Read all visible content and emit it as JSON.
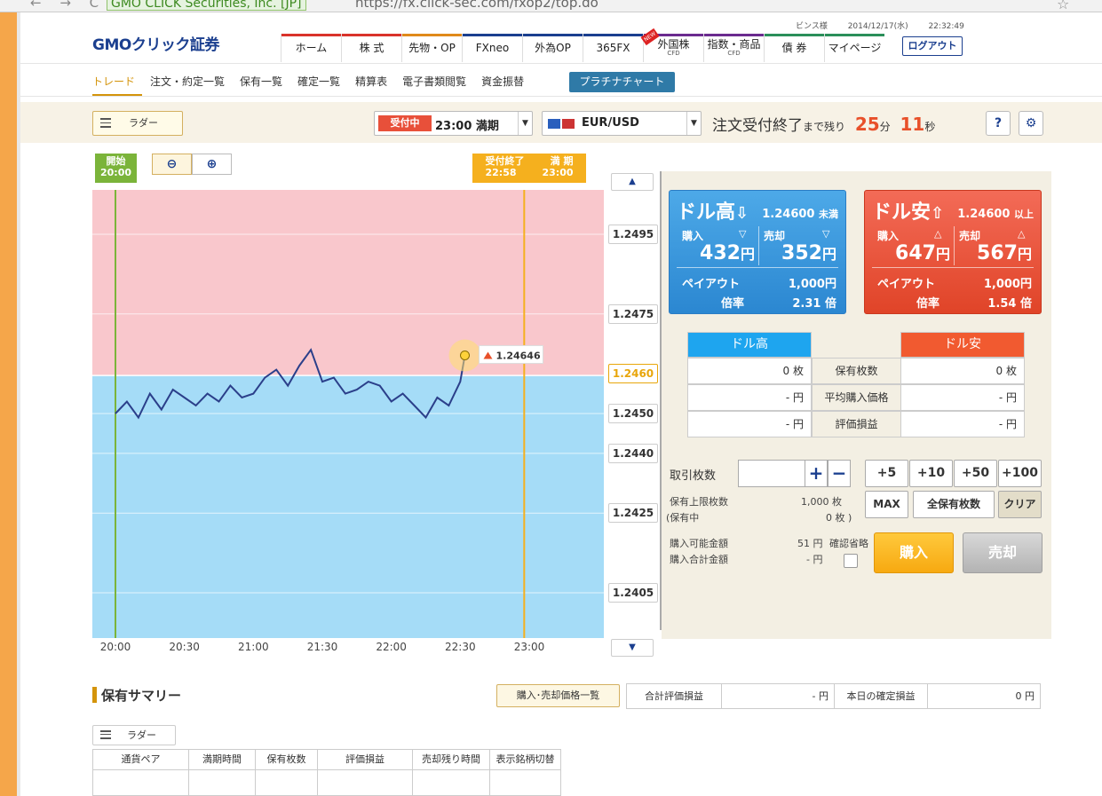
{
  "browser": {
    "secure_label": "GMO CLICK Securities, Inc. [JP]",
    "url": "https://fx.click-sec.com/fxop2/top.do"
  },
  "header": {
    "logo_text": "GMOクリック証券",
    "user": "ビンス様",
    "datetime": "2014/12/17(水) 22:32:49",
    "nav": [
      {
        "label": "ホーム",
        "sub": "",
        "color": "#d9322b"
      },
      {
        "label": "株 式",
        "sub": "",
        "color": "#d9322b"
      },
      {
        "label": "先物・OP",
        "sub": "",
        "color": "#e08a1a"
      },
      {
        "label": "FXneo",
        "sub": "",
        "color": "#1b3f8f"
      },
      {
        "label": "外為OP",
        "sub": "",
        "color": "#1b3f8f"
      },
      {
        "label": "365FX",
        "sub": "",
        "color": "#1b3f8f"
      },
      {
        "label": "外国株",
        "sub": "CFD",
        "color": "#6b2b8f",
        "new": "NEW"
      },
      {
        "label": "指数・商品",
        "sub": "CFD",
        "color": "#6b2b8f"
      },
      {
        "label": "債 券",
        "sub": "",
        "color": "#2b8f5a"
      },
      {
        "label": "マイページ",
        "sub": "",
        "color": "#2b8f5a"
      }
    ],
    "logout": "ログアウト"
  },
  "subnav": {
    "items": [
      "トレード",
      "注文・約定一覧",
      "保有一覧",
      "確定一覧",
      "精算表",
      "電子書類閲覧",
      "資金振替"
    ],
    "active": 0,
    "platinum": "プラチナチャート"
  },
  "controls": {
    "ladder": "ラダー",
    "status_badge": "受付中",
    "expiry": "23:00 満期",
    "pair": "EUR/USD",
    "deadline_label": "注文受付終了",
    "deadline_small": "まで残り",
    "minutes": "25",
    "min_unit": "分",
    "seconds": "11",
    "sec_unit": "秒",
    "help": "?"
  },
  "chart": {
    "start_label": "開始",
    "start_time": "20:00",
    "end_label": "受付終了",
    "end_time": "22:58",
    "expiry_label": "満 期",
    "expiry_time": "23:00",
    "y_ticks": [
      "1.2495",
      "1.2475",
      "1.2450",
      "1.2440",
      "1.2425",
      "1.2405"
    ],
    "current_rate": "1.2460",
    "last_price": "1.24646",
    "x_ticks": [
      "20:00",
      "20:30",
      "21:00",
      "21:30",
      "22:00",
      "22:30",
      "23:00"
    ],
    "colors": {
      "high": "#f9c7cc",
      "low": "#a5dcf7",
      "start": "#7bb43a",
      "end": "#f5b01e",
      "line": "#2b3f8a"
    }
  },
  "chart_data": {
    "type": "line",
    "x_range": [
      "20:00",
      "23:00"
    ],
    "ylim": [
      1.24,
      1.25
    ],
    "strike": 1.246,
    "series": [
      {
        "x": [
          "20:00",
          "20:05",
          "20:10",
          "20:15",
          "20:20",
          "20:25",
          "20:30",
          "20:35",
          "20:40",
          "20:45",
          "20:50",
          "20:55",
          "21:00",
          "21:05",
          "21:10",
          "21:15",
          "21:20",
          "21:25",
          "21:30",
          "21:35",
          "21:40",
          "21:45",
          "21:50",
          "21:55",
          "22:00",
          "22:05",
          "22:10",
          "22:15",
          "22:20",
          "22:25",
          "22:30",
          "22:32"
        ],
        "y": [
          1.245,
          1.2453,
          1.2449,
          1.2455,
          1.2451,
          1.2456,
          1.2454,
          1.2452,
          1.2455,
          1.2453,
          1.2457,
          1.2454,
          1.2455,
          1.2459,
          1.2461,
          1.2457,
          1.2462,
          1.2466,
          1.2458,
          1.2459,
          1.2455,
          1.2456,
          1.2458,
          1.2457,
          1.2453,
          1.2455,
          1.2452,
          1.2449,
          1.2454,
          1.2452,
          1.2458,
          1.24646
        ]
      }
    ]
  },
  "trade": {
    "high": {
      "title": "ドル高",
      "strike": "1.24600",
      "strike_unit": "未満",
      "buy_label": "購入",
      "sell_label": "売却",
      "buy_price": "432",
      "sell_price": "352",
      "yen": "円",
      "payout_label": "ペイアウト",
      "payout": "1,000",
      "rate_label": "倍率",
      "rate": "2.31",
      "rate_unit": "倍"
    },
    "low": {
      "title": "ドル安",
      "strike": "1.24600",
      "strike_unit": "以上",
      "buy_label": "購入",
      "sell_label": "売却",
      "buy_price": "647",
      "sell_price": "567",
      "yen": "円",
      "payout_label": "ペイアウト",
      "payout": "1,000",
      "rate_label": "倍率",
      "rate": "1.54",
      "rate_unit": "倍"
    }
  },
  "holdings": {
    "high_header": "ドル高",
    "low_header": "ドル安",
    "rows": [
      {
        "label": "保有枚数",
        "high": "0 枚",
        "low": "0 枚"
      },
      {
        "label": "平均購入価格",
        "high": "- 円",
        "low": "- 円"
      },
      {
        "label": "評価損益",
        "high": "- 円",
        "low": "- 円"
      }
    ]
  },
  "order": {
    "qty_label": "取引枚数",
    "plus": "+",
    "minus": "−",
    "quick": [
      "+5",
      "+10",
      "+50",
      "+100"
    ],
    "max": "MAX",
    "all_holdings": "全保有枚数",
    "clear": "クリア",
    "limit_label": "保有上限枚数",
    "limit_value": "1,000 枚",
    "holding_label": "(保有中",
    "holding_value": "0 枚 )",
    "available_label": "購入可能金額",
    "available_value": "51 円",
    "total_label": "購入合計金額",
    "total_value": "- 円",
    "confirm_label": "確認省略",
    "buy": "購入",
    "sell": "売却"
  },
  "summary": {
    "title": "保有サマリー",
    "price_list": "購入･売却価格一覧",
    "total_pl_label": "合計評価損益",
    "total_pl": "- 円",
    "today_label": "本日の確定損益",
    "today": "0 円",
    "ladder": "ラダー",
    "columns": [
      "通貨ペア",
      "満期時間",
      "保有枚数",
      "評価損益",
      "売却残り時間",
      "表示銘柄切替"
    ]
  }
}
